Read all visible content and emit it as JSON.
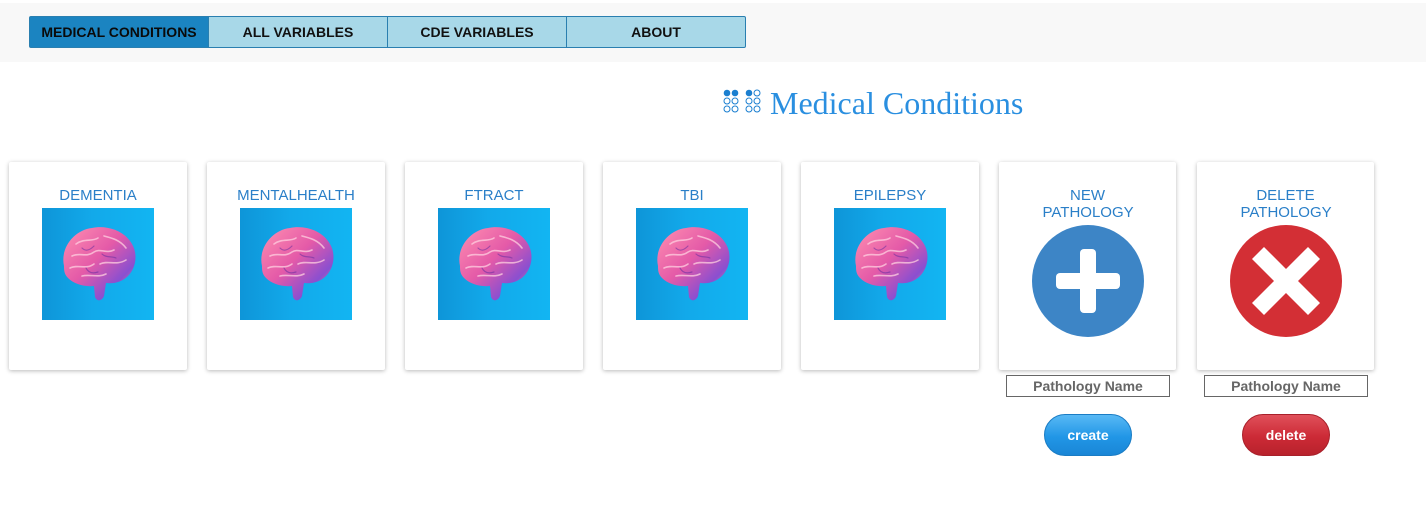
{
  "nav": {
    "tabs": [
      {
        "label": "MEDICAL CONDITIONS",
        "active": true
      },
      {
        "label": "ALL VARIABLES",
        "active": false
      },
      {
        "label": "CDE VARIABLES",
        "active": false
      },
      {
        "label": "ABOUT",
        "active": false
      }
    ]
  },
  "page": {
    "title": "Medical Conditions",
    "title_icon": "dots-grid-icon",
    "accent_color": "#2a8fe0"
  },
  "pathologies": [
    {
      "label": "DEMENTIA",
      "icon": "brain-icon"
    },
    {
      "label": "MENTALHEALTH",
      "icon": "brain-icon"
    },
    {
      "label": "FTRACT",
      "icon": "brain-icon"
    },
    {
      "label": "TBI",
      "icon": "brain-icon"
    },
    {
      "label": "EPILEPSY",
      "icon": "brain-icon"
    }
  ],
  "new_pathology": {
    "label": "NEW PATHOLOGY",
    "icon": "plus-circle-icon",
    "icon_color": "#3d85c6",
    "input_placeholder": "Pathology Name",
    "input_value": "",
    "button_label": "create"
  },
  "delete_pathology": {
    "label": "DELETE PATHOLOGY",
    "icon": "x-circle-icon",
    "icon_color": "#d32f35",
    "input_placeholder": "Pathology Name",
    "input_value": "",
    "button_label": "delete"
  }
}
